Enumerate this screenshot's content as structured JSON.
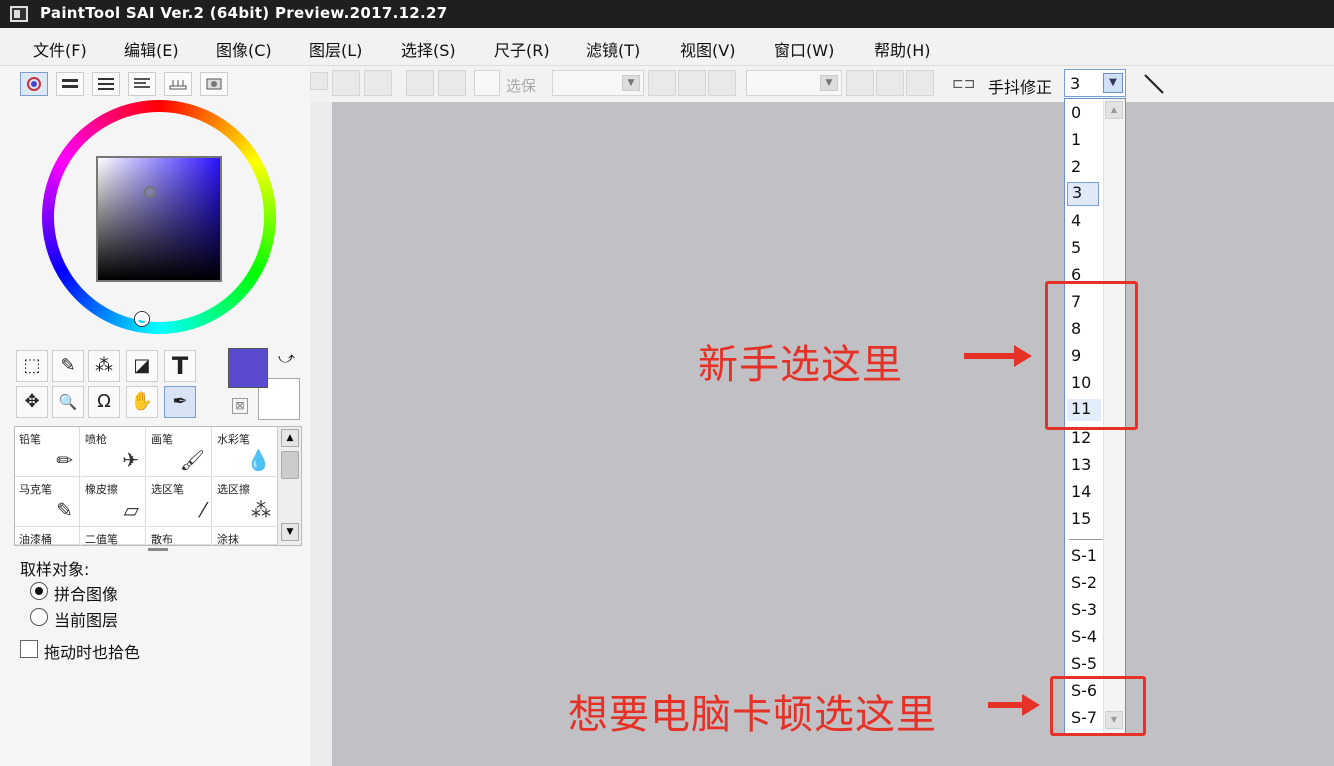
{
  "window": {
    "title": "PaintTool SAI Ver.2 (64bit) Preview.2017.12.27"
  },
  "menu": [
    {
      "label": "文件(F)"
    },
    {
      "label": "编辑(E)"
    },
    {
      "label": "图像(C)"
    },
    {
      "label": "图层(L)"
    },
    {
      "label": "选择(S)"
    },
    {
      "label": "尺子(R)"
    },
    {
      "label": "滤镜(T)"
    },
    {
      "label": "视图(V)"
    },
    {
      "label": "窗口(W)"
    },
    {
      "label": "帮助(H)"
    }
  ],
  "colors": {
    "foreground": "#5a4bd0",
    "background": "#ffffff",
    "canvas": "#c1c0c4",
    "annotation": "#e53126"
  },
  "tools": [
    {
      "name": "rect-select",
      "glyph": "⬚"
    },
    {
      "name": "lasso",
      "glyph": "✎"
    },
    {
      "name": "magic-wand",
      "glyph": "⁂"
    },
    {
      "name": "shape",
      "glyph": "◪"
    },
    {
      "name": "text",
      "glyph": "T"
    },
    {
      "name": "move",
      "glyph": "✥"
    },
    {
      "name": "zoom",
      "glyph": "🔍"
    },
    {
      "name": "rotate",
      "glyph": "Ω"
    },
    {
      "name": "hand",
      "glyph": "✋"
    },
    {
      "name": "eyedropper",
      "glyph": "✒"
    }
  ],
  "brushes": [
    {
      "label": "铅笔",
      "glyph": "✏"
    },
    {
      "label": "喷枪",
      "glyph": "✈"
    },
    {
      "label": "画笔",
      "glyph": "🖌"
    },
    {
      "label": "水彩笔",
      "glyph": "💧"
    },
    {
      "label": "马克笔",
      "glyph": "✎"
    },
    {
      "label": "橡皮擦",
      "glyph": "▱"
    },
    {
      "label": "选区笔",
      "glyph": "⁄"
    },
    {
      "label": "选区擦",
      "glyph": "⁂"
    },
    {
      "label": "油漆桶",
      "glyph": ""
    },
    {
      "label": "二值笔",
      "glyph": ""
    },
    {
      "label": "散布",
      "glyph": ""
    },
    {
      "label": "涂抹",
      "glyph": ""
    }
  ],
  "sampling": {
    "title": "取样对象:",
    "options": [
      {
        "label": "拼合图像",
        "checked": true
      },
      {
        "label": "当前图层",
        "checked": false
      }
    ],
    "checkbox_label": "拖动时也拾色"
  },
  "toolbar": {
    "disabled_label": "选保",
    "stabilizer_label": "手抖修正",
    "stabilizer_value": "3"
  },
  "stabilizer_options": [
    "0",
    "1",
    "2",
    "3",
    "4",
    "5",
    "6",
    "7",
    "8",
    "9",
    "10",
    "11",
    "12",
    "13",
    "14",
    "15",
    "S-1",
    "S-2",
    "S-3",
    "S-4",
    "S-5",
    "S-6",
    "S-7"
  ],
  "annotations": {
    "beginner": "新手选这里",
    "laggy": "想要电脑卡顿选这里"
  }
}
